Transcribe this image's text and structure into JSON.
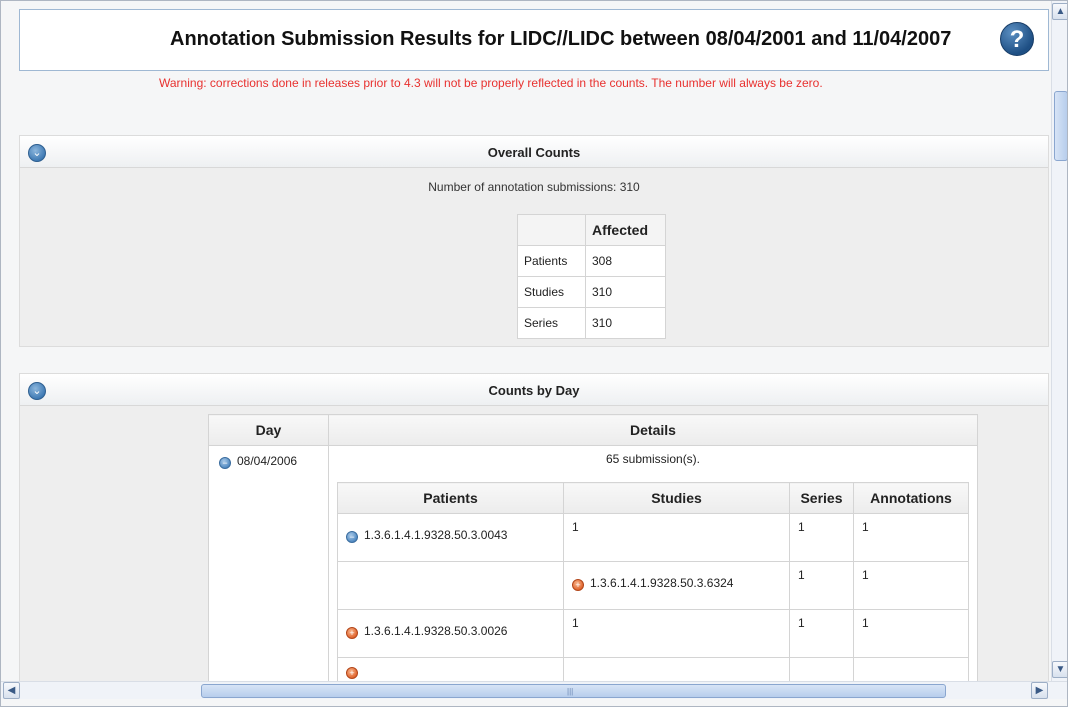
{
  "header": {
    "title": "Annotation Submission Results for LIDC//LIDC between 08/04/2001 and 11/04/2007",
    "help_icon": "question-mark-icon",
    "warning": "Warning: corrections done in releases prior to 4.3 will not be properly reflected in the counts. The number will always be zero."
  },
  "overall": {
    "title": "Overall Counts",
    "submissions_text": "Number of annotation submissions: 310",
    "column_header": "Affected",
    "rows": [
      {
        "label": "Patients",
        "value": "308"
      },
      {
        "label": "Studies",
        "value": "310"
      },
      {
        "label": "Series",
        "value": "310"
      }
    ]
  },
  "by_day": {
    "title": "Counts by Day",
    "col_day": "Day",
    "col_details": "Details",
    "day": "08/04/2006",
    "submissions": "65 submission(s).",
    "inner_headers": {
      "patients": "Patients",
      "studies": "Studies",
      "series": "Series",
      "annotations": "Annotations"
    },
    "rows": [
      {
        "patient": "1.3.6.1.4.1.9328.50.3.0043",
        "studies": "1",
        "series": "1",
        "annotations": "1"
      },
      {
        "patient": "",
        "studies": "1.3.6.1.4.1.9328.50.3.6324",
        "series": "1",
        "annotations": "1"
      },
      {
        "patient": "1.3.6.1.4.1.9328.50.3.0026",
        "studies": "1",
        "series": "1",
        "annotations": "1"
      }
    ]
  },
  "colors": {
    "warning": "#e8312f",
    "accent": "#3b77b2",
    "expand_icon": "#e0622a"
  }
}
